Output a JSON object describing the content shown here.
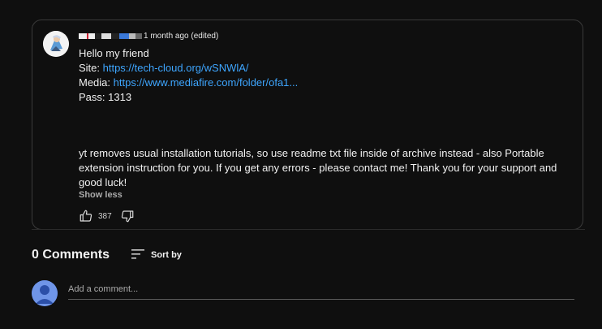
{
  "comment": {
    "timestamp": "1 month ago (edited)",
    "lines": {
      "greeting": "Hello my friend",
      "site_label": "Site: ",
      "site_link": "https://tech-cloud.org/wSNWlA/",
      "media_label": "Media: ",
      "media_link": "https://www.mediafire.com/folder/ofa1...",
      "pass": "Pass: 1313"
    },
    "paragraph": "yt removes usual installation tutorials, so use readme txt file inside of archive instead - also Portable extension instruction for you. If you get any errors - please contact me! Thank you for your support and good luck!",
    "show_less": "Show less",
    "like_count": "387"
  },
  "comments_section": {
    "count_label": "0 Comments",
    "sort_label": "Sort by",
    "add_placeholder": "Add a comment..."
  },
  "icons": {
    "like": "thumbs-up-icon",
    "dislike": "thumbs-down-icon",
    "sort": "sort-icon"
  }
}
